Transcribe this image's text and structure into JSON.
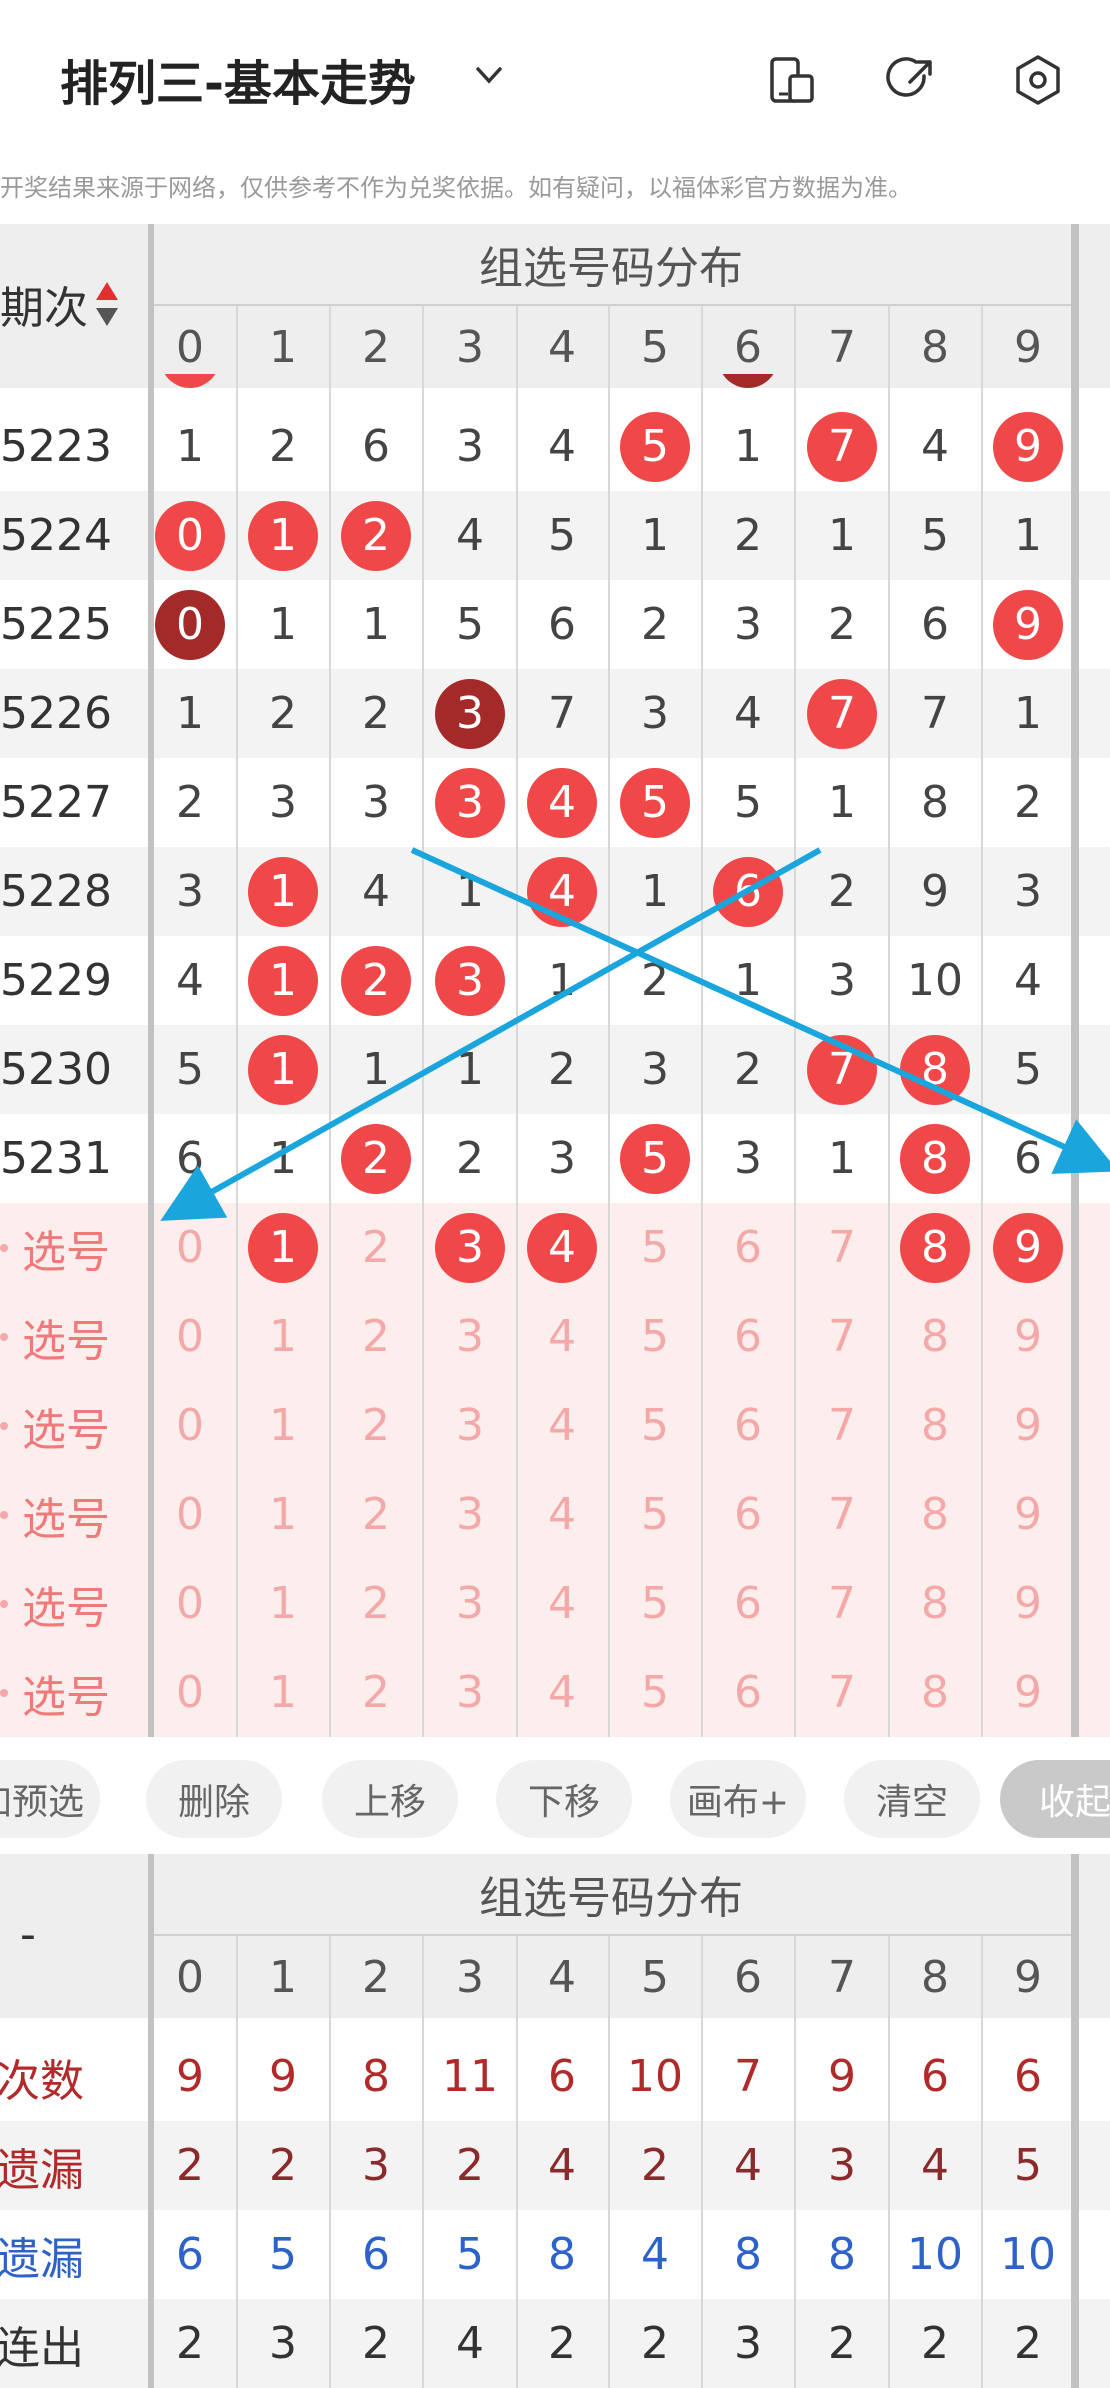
{
  "header": {
    "title": "排列三-基本走势",
    "icons": [
      "chevron-down-icon",
      "phone-icon",
      "share-icon",
      "settings-icon"
    ]
  },
  "notice": "开奖结果来源于网络，仅供参考不作为兑奖依据。如有疑问，以福体彩官方数据为准。",
  "grid": {
    "section_title": "组选号码分布",
    "issue_header": "期次",
    "sort_icon": "sort-up-down-icon",
    "digits": [
      "0",
      "1",
      "2",
      "3",
      "4",
      "5",
      "6",
      "7",
      "8",
      "9"
    ],
    "rows": [
      {
        "issue": "5223",
        "cells": [
          "1",
          "2",
          "6",
          "3",
          "4",
          "5",
          "1",
          "7",
          "4",
          "9"
        ],
        "balls": [
          5,
          7,
          9
        ],
        "dark": []
      },
      {
        "issue": "5224",
        "cells": [
          "0",
          "1",
          "2",
          "4",
          "5",
          "1",
          "2",
          "1",
          "5",
          "1"
        ],
        "balls": [
          0,
          1,
          2
        ],
        "dark": []
      },
      {
        "issue": "5225",
        "cells": [
          "0",
          "1",
          "1",
          "5",
          "6",
          "2",
          "3",
          "2",
          "6",
          "9"
        ],
        "balls": [
          0,
          9
        ],
        "dark": [
          0
        ]
      },
      {
        "issue": "5226",
        "cells": [
          "1",
          "2",
          "2",
          "3",
          "7",
          "3",
          "4",
          "7",
          "7",
          "1"
        ],
        "balls": [
          3,
          7
        ],
        "dark": [
          3
        ]
      },
      {
        "issue": "5227",
        "cells": [
          "2",
          "3",
          "3",
          "3",
          "4",
          "5",
          "5",
          "1",
          "8",
          "2"
        ],
        "balls": [
          3,
          4,
          5
        ],
        "dark": []
      },
      {
        "issue": "5228",
        "cells": [
          "3",
          "1",
          "4",
          "1",
          "4",
          "1",
          "6",
          "2",
          "9",
          "3"
        ],
        "balls": [
          1,
          4,
          6
        ],
        "dark": []
      },
      {
        "issue": "5229",
        "cells": [
          "4",
          "1",
          "2",
          "3",
          "1",
          "2",
          "1",
          "3",
          "10",
          "4"
        ],
        "balls": [
          1,
          2,
          3
        ],
        "dark": []
      },
      {
        "issue": "5230",
        "cells": [
          "5",
          "1",
          "1",
          "1",
          "2",
          "3",
          "2",
          "7",
          "8",
          "5"
        ],
        "balls": [
          1,
          7,
          8
        ],
        "dark": []
      },
      {
        "issue": "5231",
        "cells": [
          "6",
          "1",
          "2",
          "2",
          "3",
          "5",
          "3",
          "1",
          "8",
          "6"
        ],
        "balls": [
          2,
          5,
          8
        ],
        "dark": []
      }
    ],
    "select_label": "选号",
    "select_rows": [
      {
        "selected": [
          1,
          3,
          4,
          8,
          9
        ]
      },
      {
        "selected": []
      },
      {
        "selected": []
      },
      {
        "selected": []
      },
      {
        "selected": []
      },
      {
        "selected": []
      }
    ]
  },
  "toolbar": {
    "buttons": [
      "加预选",
      "删除",
      "上移",
      "下移",
      "画布+",
      "清空",
      "收起"
    ]
  },
  "stats": {
    "section_title": "组选号码分布",
    "corner": "-",
    "digits": [
      "0",
      "1",
      "2",
      "3",
      "4",
      "5",
      "6",
      "7",
      "8",
      "9"
    ],
    "rows": [
      {
        "label": "现次数",
        "color": "#b02a2a",
        "label_color": "#b02a2a",
        "values": [
          "9",
          "9",
          "8",
          "11",
          "6",
          "10",
          "7",
          "9",
          "6",
          "6"
        ]
      },
      {
        "label": "均遗漏",
        "color": "#8a2a2a",
        "label_color": "#b02a2a",
        "values": [
          "2",
          "2",
          "3",
          "2",
          "4",
          "2",
          "4",
          "3",
          "4",
          "5"
        ]
      },
      {
        "label": "大遗漏",
        "color": "#2d62c8",
        "label_color": "#2d62c8",
        "values": [
          "6",
          "5",
          "6",
          "5",
          "8",
          "4",
          "8",
          "8",
          "10",
          "10"
        ]
      },
      {
        "label": "大连出",
        "color": "#333333",
        "label_color": "#333333",
        "values": [
          "2",
          "3",
          "2",
          "4",
          "2",
          "2",
          "3",
          "2",
          "2",
          "2"
        ]
      }
    ]
  },
  "colors": {
    "ball_red": "#f04848",
    "ball_dark": "#a42a2a",
    "select_bg": "#fdeeee",
    "arrow_blue": "#1aa6dc"
  }
}
